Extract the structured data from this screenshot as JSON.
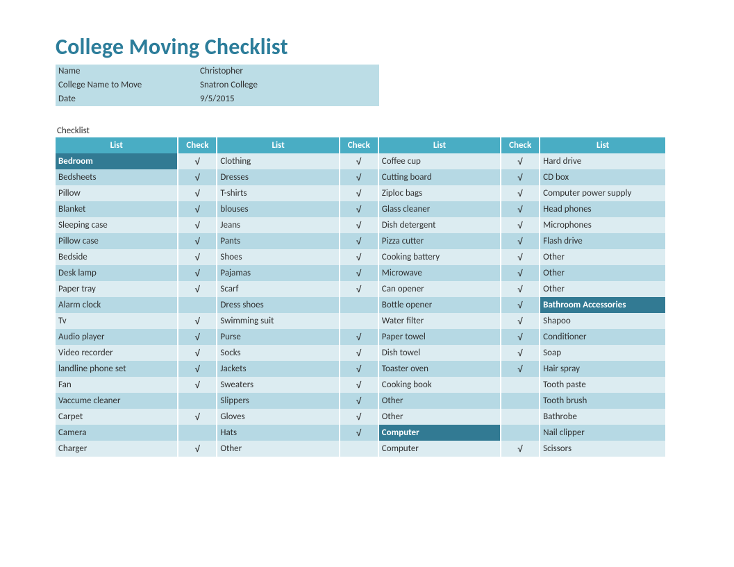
{
  "title": "College Moving Checklist",
  "info": {
    "name_label": "Name",
    "name_value": "Christopher",
    "college_label": "College Name to Move",
    "college_value": "Snatron College",
    "date_label": "Date",
    "date_value": "9/5/2015"
  },
  "checklist_label": "Checklist",
  "headers": {
    "list": "List",
    "check": "Check"
  },
  "check_mark": "√",
  "rows": [
    {
      "c0": {
        "t": "Bedroom",
        "section": true
      },
      "k0": "√",
      "c1": {
        "t": "Clothing"
      },
      "k1": "√",
      "c2": {
        "t": "Coffee cup"
      },
      "k2": "√",
      "c3": {
        "t": "Hard drive"
      }
    },
    {
      "c0": {
        "t": "Bedsheets"
      },
      "k0": "√",
      "c1": {
        "t": "Dresses"
      },
      "k1": "√",
      "c2": {
        "t": "Cutting board"
      },
      "k2": "√",
      "c3": {
        "t": "CD box"
      }
    },
    {
      "c0": {
        "t": "Pillow"
      },
      "k0": "√",
      "c1": {
        "t": "T-shirts"
      },
      "k1": "√",
      "c2": {
        "t": "Ziploc bags"
      },
      "k2": "√",
      "c3": {
        "t": "Computer power supply"
      }
    },
    {
      "c0": {
        "t": "Blanket"
      },
      "k0": "√",
      "c1": {
        "t": "blouses"
      },
      "k1": "√",
      "c2": {
        "t": "Glass cleaner"
      },
      "k2": "√",
      "c3": {
        "t": "Head phones"
      }
    },
    {
      "c0": {
        "t": "Sleeping case"
      },
      "k0": "√",
      "c1": {
        "t": "Jeans"
      },
      "k1": "√",
      "c2": {
        "t": "Dish detergent"
      },
      "k2": "√",
      "c3": {
        "t": "Microphones"
      }
    },
    {
      "c0": {
        "t": "Pillow case"
      },
      "k0": "√",
      "c1": {
        "t": "Pants"
      },
      "k1": "√",
      "c2": {
        "t": "Pizza cutter"
      },
      "k2": "√",
      "c3": {
        "t": "Flash drive"
      }
    },
    {
      "c0": {
        "t": "Bedside"
      },
      "k0": "√",
      "c1": {
        "t": "Shoes"
      },
      "k1": "√",
      "c2": {
        "t": "Cooking battery"
      },
      "k2": "√",
      "c3": {
        "t": "Other"
      }
    },
    {
      "c0": {
        "t": "Desk lamp"
      },
      "k0": "√",
      "c1": {
        "t": "Pajamas"
      },
      "k1": "√",
      "c2": {
        "t": "Microwave"
      },
      "k2": "√",
      "c3": {
        "t": "Other"
      }
    },
    {
      "c0": {
        "t": "Paper tray"
      },
      "k0": "√",
      "c1": {
        "t": "Scarf"
      },
      "k1": "√",
      "c2": {
        "t": "Can opener"
      },
      "k2": "√",
      "c3": {
        "t": "Other"
      }
    },
    {
      "c0": {
        "t": "Alarm clock"
      },
      "k0": "",
      "c1": {
        "t": "Dress shoes"
      },
      "k1": "",
      "c2": {
        "t": "Bottle opener"
      },
      "k2": "√",
      "c3": {
        "t": "Bathroom Accessories",
        "section": true
      }
    },
    {
      "c0": {
        "t": "Tv"
      },
      "k0": "√",
      "c1": {
        "t": "Swimming suit"
      },
      "k1": "",
      "c2": {
        "t": "Water filter"
      },
      "k2": "√",
      "c3": {
        "t": "Shapoo"
      }
    },
    {
      "c0": {
        "t": "Audio player"
      },
      "k0": "√",
      "c1": {
        "t": "Purse"
      },
      "k1": "√",
      "c2": {
        "t": "Paper towel"
      },
      "k2": "√",
      "c3": {
        "t": "Conditioner"
      }
    },
    {
      "c0": {
        "t": "Video recorder"
      },
      "k0": "√",
      "c1": {
        "t": "Socks"
      },
      "k1": "√",
      "c2": {
        "t": "Dish towel"
      },
      "k2": "√",
      "c3": {
        "t": "Soap"
      }
    },
    {
      "c0": {
        "t": "landline phone set"
      },
      "k0": "√",
      "c1": {
        "t": "Jackets"
      },
      "k1": "√",
      "c2": {
        "t": "Toaster oven"
      },
      "k2": "√",
      "c3": {
        "t": "Hair spray"
      }
    },
    {
      "c0": {
        "t": "Fan"
      },
      "k0": "√",
      "c1": {
        "t": "Sweaters"
      },
      "k1": "√",
      "c2": {
        "t": "Cooking book"
      },
      "k2": "",
      "c3": {
        "t": "Tooth paste"
      }
    },
    {
      "c0": {
        "t": "Vaccume cleaner"
      },
      "k0": "",
      "c1": {
        "t": "Slippers"
      },
      "k1": "√",
      "c2": {
        "t": "Other"
      },
      "k2": "",
      "c3": {
        "t": "Tooth brush"
      }
    },
    {
      "c0": {
        "t": "Carpet"
      },
      "k0": "√",
      "c1": {
        "t": "Gloves"
      },
      "k1": "√",
      "c2": {
        "t": "Other"
      },
      "k2": "",
      "c3": {
        "t": "Bathrobe"
      }
    },
    {
      "c0": {
        "t": "Camera"
      },
      "k0": "",
      "c1": {
        "t": "Hats"
      },
      "k1": "√",
      "c2": {
        "t": "Computer",
        "section": true
      },
      "k2": "",
      "c3": {
        "t": "Nail clipper"
      }
    },
    {
      "c0": {
        "t": "Charger"
      },
      "k0": "√",
      "c1": {
        "t": "Other"
      },
      "k1": "",
      "c2": {
        "t": "Computer"
      },
      "k2": "√",
      "c3": {
        "t": "Scissors"
      }
    }
  ]
}
